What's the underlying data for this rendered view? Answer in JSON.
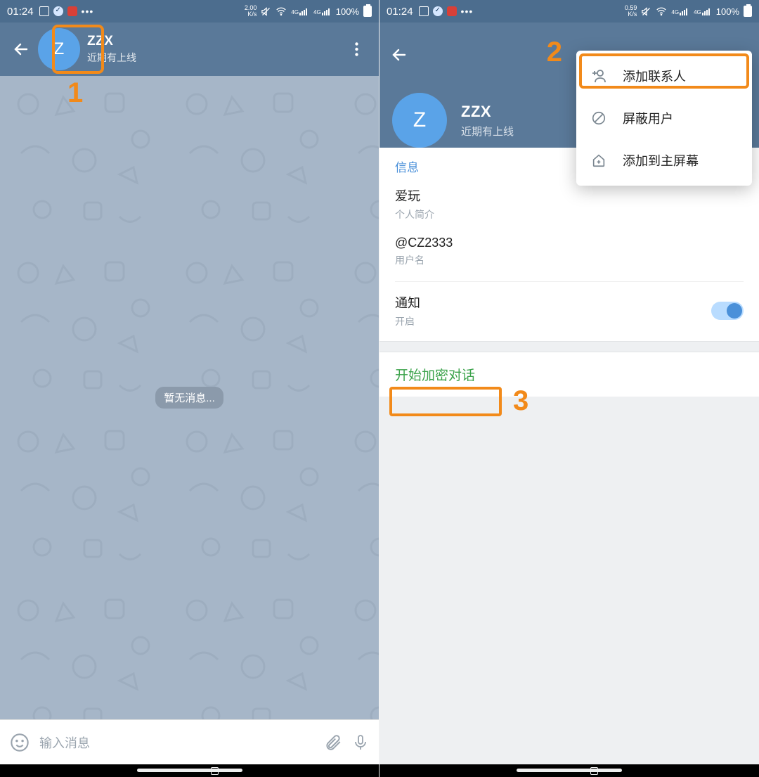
{
  "annotations": {
    "step1": "1",
    "step2": "2",
    "step3": "3"
  },
  "screen1": {
    "status": {
      "time": "01:24",
      "speed_top": "2.00",
      "speed_bot": "K/s",
      "battery": "100%",
      "net_label": "4G"
    },
    "header": {
      "avatar_letter": "Z",
      "name": "ZZX",
      "status": "近期有上线"
    },
    "body": {
      "empty": "暂无消息..."
    },
    "input": {
      "placeholder": "输入消息"
    }
  },
  "screen2": {
    "status": {
      "time": "01:24",
      "speed_top": "0.59",
      "speed_bot": "K/s",
      "battery": "100%",
      "net_label": "4G"
    },
    "header": {
      "avatar_letter": "Z",
      "name": "ZZX",
      "status": "近期有上线"
    },
    "menu": {
      "items": [
        {
          "label": "添加联系人"
        },
        {
          "label": "屏蔽用户"
        },
        {
          "label": "添加到主屏幕"
        }
      ]
    },
    "info": {
      "title": "信息",
      "bio_value": "爱玩",
      "bio_label": "个人简介",
      "username_value": "@CZ2333",
      "username_label": "用户名",
      "notif_title": "通知",
      "notif_sub": "开启"
    },
    "encrypt": "开始加密对话"
  }
}
